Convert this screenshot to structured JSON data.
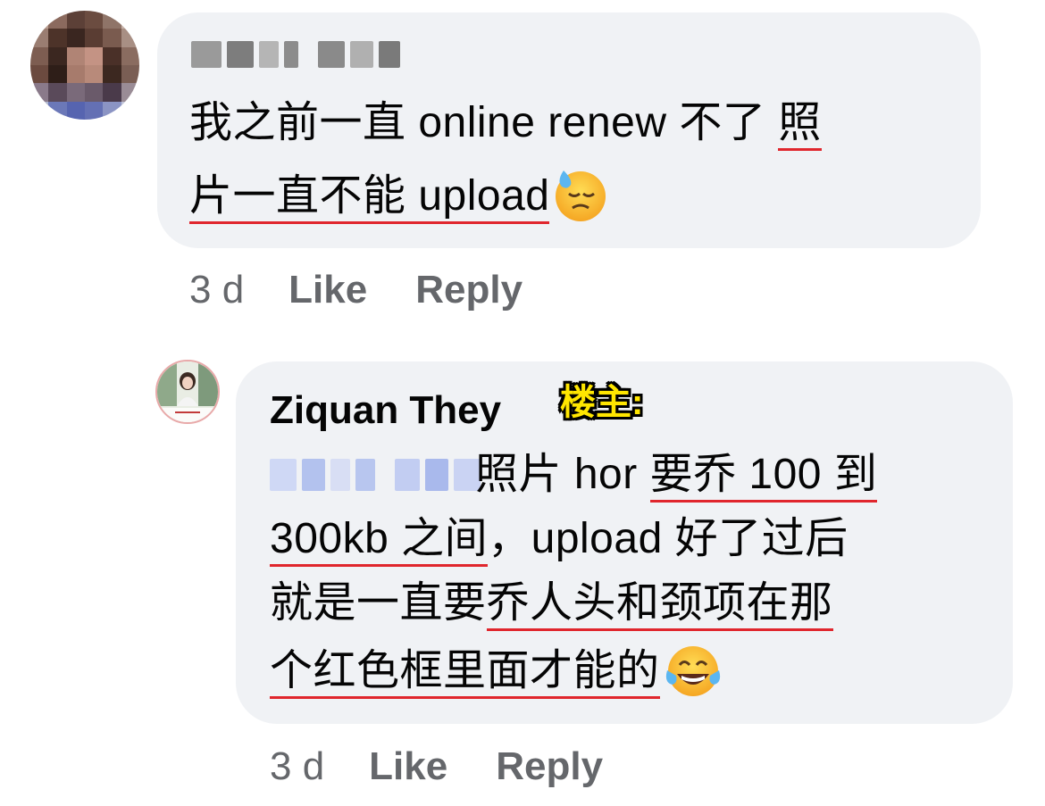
{
  "comment1": {
    "author_name_hidden": "Mei Lim",
    "line1_plain": "我之前一直 online renew 不了 ",
    "line1_ul": "照",
    "line2_ul": "片一直不能 upload",
    "emoji_icon": "downcast-sweat-face",
    "meta": {
      "time": "3 d",
      "like": "Like",
      "reply": "Reply"
    }
  },
  "comment2": {
    "author": "Ziquan They",
    "badge": "楼主:",
    "mention_hidden": "Mei Lim",
    "line1_plain": " 照片 hor ",
    "line1_ul": "要乔 100 到",
    "line2_ul": "300kb 之间",
    "line2_plain": "，upload 好了过后",
    "line3_plain": "就是一直要",
    "line3_ul": "乔人头和颈项在那",
    "line4_ul": "个红色框里面才能的",
    "emoji_icon": "tears-of-joy-face",
    "meta": {
      "time": "3 d",
      "like": "Like",
      "reply": "Reply"
    }
  },
  "colors": {
    "bubble": "#f0f2f5",
    "underline": "#e0262d",
    "meta_text": "#65676b",
    "badge": "#ffe600"
  }
}
